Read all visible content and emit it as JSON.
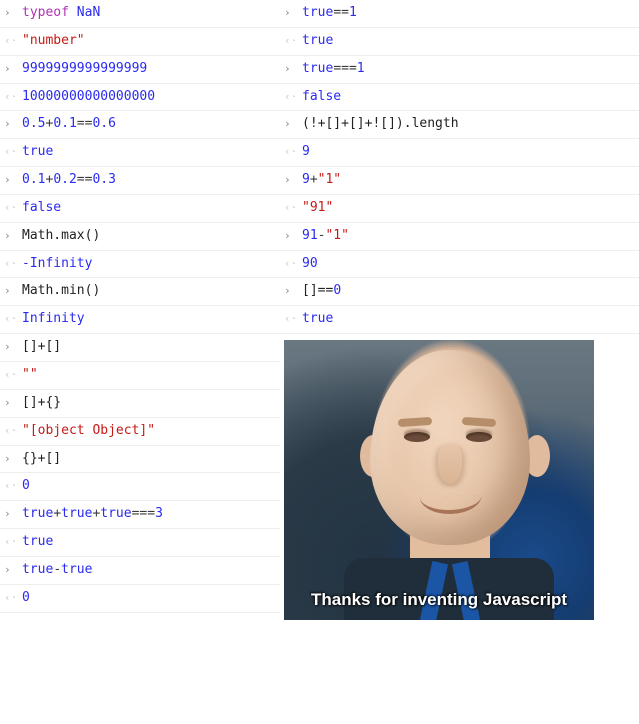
{
  "left": [
    {
      "type": "in",
      "tokens": [
        {
          "c": "tk-keyword",
          "t": "typeof"
        },
        {
          "c": "tk-text",
          "t": " "
        },
        {
          "c": "tk-literal",
          "t": "NaN"
        }
      ]
    },
    {
      "type": "out",
      "tokens": [
        {
          "c": "tk-output-string",
          "t": "\"number\""
        }
      ]
    },
    {
      "type": "in",
      "tokens": [
        {
          "c": "tk-number",
          "t": "9999999999999999"
        }
      ]
    },
    {
      "type": "out",
      "tokens": [
        {
          "c": "tk-output-number",
          "t": "10000000000000000"
        }
      ]
    },
    {
      "type": "in",
      "tokens": [
        {
          "c": "tk-number",
          "t": "0.5"
        },
        {
          "c": "tk-operator",
          "t": "+"
        },
        {
          "c": "tk-number",
          "t": "0.1"
        },
        {
          "c": "tk-operator",
          "t": "=="
        },
        {
          "c": "tk-number",
          "t": "0.6"
        }
      ]
    },
    {
      "type": "out",
      "tokens": [
        {
          "c": "tk-output-literal",
          "t": "true"
        }
      ]
    },
    {
      "type": "in",
      "tokens": [
        {
          "c": "tk-number",
          "t": "0.1"
        },
        {
          "c": "tk-operator",
          "t": "+"
        },
        {
          "c": "tk-number",
          "t": "0.2"
        },
        {
          "c": "tk-operator",
          "t": "=="
        },
        {
          "c": "tk-number",
          "t": "0.3"
        }
      ]
    },
    {
      "type": "out",
      "tokens": [
        {
          "c": "tk-output-literal",
          "t": "false"
        }
      ]
    },
    {
      "type": "in",
      "tokens": [
        {
          "c": "tk-text",
          "t": "Math.max()"
        }
      ]
    },
    {
      "type": "out",
      "tokens": [
        {
          "c": "tk-output-number",
          "t": "-Infinity"
        }
      ]
    },
    {
      "type": "in",
      "tokens": [
        {
          "c": "tk-text",
          "t": "Math.min()"
        }
      ]
    },
    {
      "type": "out",
      "tokens": [
        {
          "c": "tk-output-number",
          "t": "Infinity"
        }
      ]
    },
    {
      "type": "in",
      "tokens": [
        {
          "c": "tk-text",
          "t": "[]+[]"
        }
      ]
    },
    {
      "type": "out",
      "tokens": [
        {
          "c": "tk-output-string",
          "t": "\"\""
        }
      ]
    },
    {
      "type": "in",
      "tokens": [
        {
          "c": "tk-text",
          "t": "[]+{}"
        }
      ]
    },
    {
      "type": "out",
      "tokens": [
        {
          "c": "tk-output-string",
          "t": "\"[object Object]\""
        }
      ]
    },
    {
      "type": "in",
      "tokens": [
        {
          "c": "tk-text",
          "t": "{}+[]"
        }
      ]
    },
    {
      "type": "out",
      "tokens": [
        {
          "c": "tk-output-number",
          "t": "0"
        }
      ]
    },
    {
      "type": "in",
      "tokens": [
        {
          "c": "tk-literal",
          "t": "true"
        },
        {
          "c": "tk-operator",
          "t": "+"
        },
        {
          "c": "tk-literal",
          "t": "true"
        },
        {
          "c": "tk-operator",
          "t": "+"
        },
        {
          "c": "tk-literal",
          "t": "true"
        },
        {
          "c": "tk-operator",
          "t": "==="
        },
        {
          "c": "tk-number",
          "t": "3"
        }
      ]
    },
    {
      "type": "out",
      "tokens": [
        {
          "c": "tk-output-literal",
          "t": "true"
        }
      ]
    },
    {
      "type": "in",
      "tokens": [
        {
          "c": "tk-literal",
          "t": "true"
        },
        {
          "c": "tk-operator",
          "t": "-"
        },
        {
          "c": "tk-literal",
          "t": "true"
        }
      ]
    },
    {
      "type": "out",
      "tokens": [
        {
          "c": "tk-output-number",
          "t": "0"
        }
      ]
    }
  ],
  "right": [
    {
      "type": "in",
      "tokens": [
        {
          "c": "tk-literal",
          "t": "true"
        },
        {
          "c": "tk-operator",
          "t": "=="
        },
        {
          "c": "tk-number",
          "t": "1"
        }
      ]
    },
    {
      "type": "out",
      "tokens": [
        {
          "c": "tk-output-literal",
          "t": "true"
        }
      ]
    },
    {
      "type": "in",
      "tokens": [
        {
          "c": "tk-literal",
          "t": "true"
        },
        {
          "c": "tk-operator",
          "t": "==="
        },
        {
          "c": "tk-number",
          "t": "1"
        }
      ]
    },
    {
      "type": "out",
      "tokens": [
        {
          "c": "tk-output-literal",
          "t": "false"
        }
      ]
    },
    {
      "type": "in",
      "tokens": [
        {
          "c": "tk-text",
          "t": "(!+[]+[]+![]).length"
        }
      ]
    },
    {
      "type": "out",
      "tokens": [
        {
          "c": "tk-output-number",
          "t": "9"
        }
      ]
    },
    {
      "type": "in",
      "tokens": [
        {
          "c": "tk-number",
          "t": "9"
        },
        {
          "c": "tk-operator",
          "t": "+"
        },
        {
          "c": "tk-string",
          "t": "\"1\""
        }
      ]
    },
    {
      "type": "out",
      "tokens": [
        {
          "c": "tk-output-string",
          "t": "\"91\""
        }
      ]
    },
    {
      "type": "in",
      "tokens": [
        {
          "c": "tk-number",
          "t": "91"
        },
        {
          "c": "tk-operator",
          "t": "-"
        },
        {
          "c": "tk-string",
          "t": "\"1\""
        }
      ]
    },
    {
      "type": "out",
      "tokens": [
        {
          "c": "tk-output-number",
          "t": "90"
        }
      ]
    },
    {
      "type": "in",
      "tokens": [
        {
          "c": "tk-text",
          "t": "[]=="
        },
        {
          "c": "tk-number",
          "t": "0"
        }
      ]
    },
    {
      "type": "out",
      "tokens": [
        {
          "c": "tk-output-literal",
          "t": "true"
        }
      ]
    }
  ],
  "icons": {
    "input": "›",
    "output": "‹·"
  },
  "meme": {
    "caption": "Thanks for inventing Javascript"
  }
}
